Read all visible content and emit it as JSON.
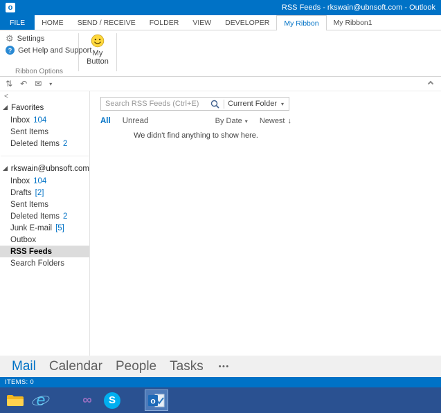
{
  "title_bar": {
    "icon_glyph": "o",
    "title": "RSS Feeds - rkswain@ubnsoft.com - Outlook"
  },
  "ribbon_tabs": [
    {
      "label": "FILE"
    },
    {
      "label": "HOME"
    },
    {
      "label": "SEND / RECEIVE"
    },
    {
      "label": "FOLDER"
    },
    {
      "label": "VIEW"
    },
    {
      "label": "DEVELOPER"
    },
    {
      "label": "My Ribbon"
    },
    {
      "label": "My Ribbon1"
    }
  ],
  "ribbon": {
    "settings_label": "Settings",
    "help_label": "Get Help and Support",
    "my_button_label": "My Button",
    "group_label": "Ribbon Options"
  },
  "icons": {
    "gear": "⚙",
    "help_qmark": "?",
    "send_receive": "⇅",
    "undo": "↶",
    "envelope": "✉",
    "qat_dropdown": "▾",
    "caret_down": "▾",
    "sort_desc_arrow": "↓",
    "collapse_pane": "<"
  },
  "folder_pane": {
    "favorites_header": "Favorites",
    "favorites": [
      {
        "label": "Inbox",
        "count": "104"
      },
      {
        "label": "Sent Items",
        "count": ""
      },
      {
        "label": "Deleted Items",
        "count": "2"
      }
    ],
    "account_header": "rkswain@ubnsoft.com",
    "account_folders": [
      {
        "label": "Inbox",
        "count": "104"
      },
      {
        "label": "Drafts",
        "count": "[2]"
      },
      {
        "label": "Sent Items",
        "count": ""
      },
      {
        "label": "Deleted Items",
        "count": "2"
      },
      {
        "label": "Junk E-mail",
        "count": "[5]"
      },
      {
        "label": "Outbox",
        "count": ""
      },
      {
        "label": "RSS Feeds",
        "count": ""
      },
      {
        "label": "Search Folders",
        "count": ""
      }
    ]
  },
  "list_pane": {
    "search_placeholder": "Search RSS Feeds (Ctrl+E)",
    "scope": "Current Folder",
    "tab_all": "All",
    "tab_unread": "Unread",
    "sort_field": "By Date",
    "sort_order": "Newest",
    "empty_message": "We didn't find anything to show here."
  },
  "nav_bar": {
    "items": [
      {
        "label": "Mail"
      },
      {
        "label": "Calendar"
      },
      {
        "label": "People"
      },
      {
        "label": "Tasks"
      }
    ],
    "more": "•••"
  },
  "status_bar": {
    "items": "ITEMS: 0"
  },
  "taskbar": {
    "glyphs": {
      "ie": "e",
      "vs": "∞",
      "skype": "S",
      "outlook": "o"
    }
  }
}
